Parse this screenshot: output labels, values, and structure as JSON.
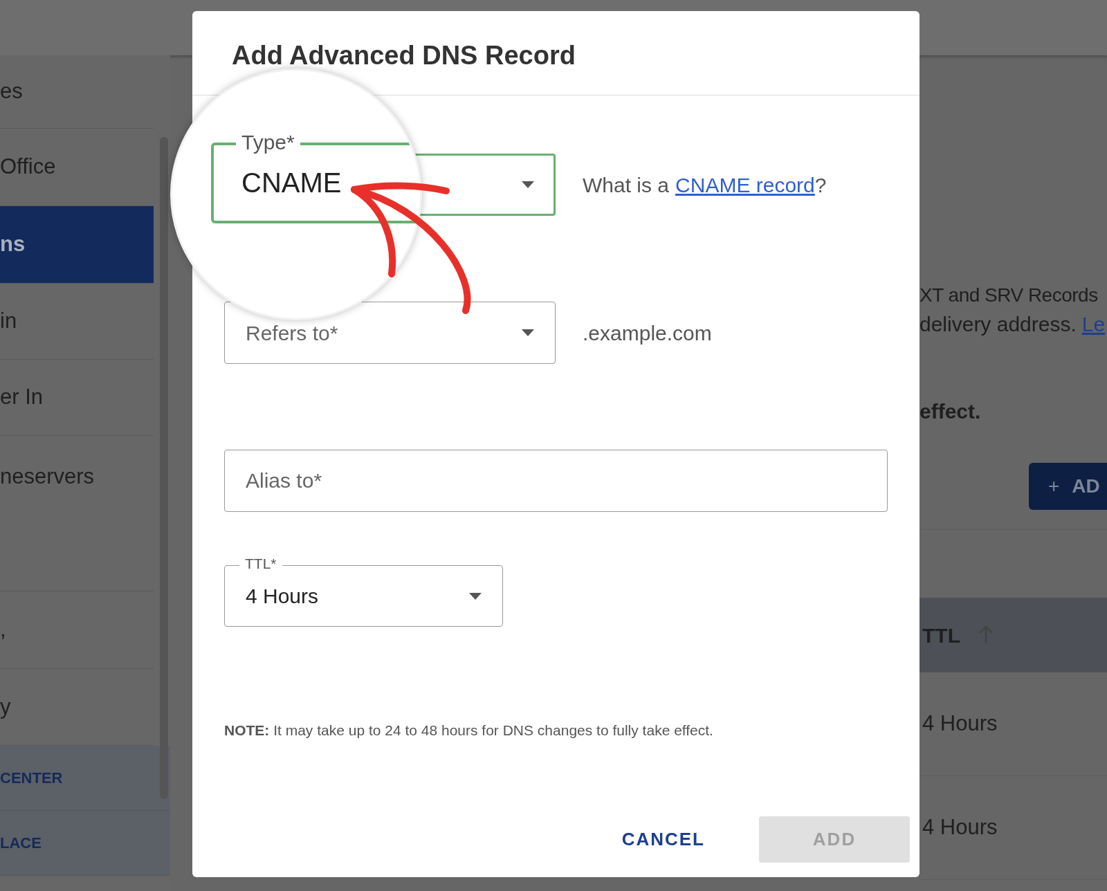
{
  "background_page": {
    "sidebar": {
      "items": [
        {
          "label": "es",
          "selected": false
        },
        {
          "label": "Office",
          "selected": false
        },
        {
          "label": "ns",
          "selected": true
        },
        {
          "label": "in",
          "selected": false
        },
        {
          "label": "er In",
          "selected": false
        },
        {
          "label": "neservers",
          "selected": false
        },
        {
          "label": ",",
          "selected": false
        },
        {
          "label": "y",
          "selected": false
        }
      ],
      "links": [
        "CENTER",
        "LACE"
      ]
    },
    "content": {
      "intro_lines": [
        "XT and SRV Records",
        "delivery address."
      ],
      "intro_link": "Le",
      "note_end": "effect.",
      "add_button": {
        "icon": "+",
        "label": "AD"
      },
      "table": {
        "columns": [
          {
            "label": "TTL",
            "sorted_ascending": true
          }
        ],
        "rows": [
          {
            "ttl": "4 Hours"
          },
          {
            "ttl": "4 Hours"
          }
        ]
      }
    }
  },
  "dialog": {
    "title": "Add Advanced DNS Record",
    "type_field": {
      "label": "Type*",
      "value": "CNAME",
      "focused": true
    },
    "help": {
      "text": "What is a ",
      "link": "CNAME record ",
      "suffix": "?"
    },
    "refers_field": {
      "placeholder": "Refers to*",
      "suffix": ".example.com"
    },
    "alias_field": {
      "placeholder": "Alias to*"
    },
    "ttl_field": {
      "label": "TTL*",
      "value": "4 Hours"
    },
    "note": "**NOTE:** It may take up to 24 to 48 hours for DNS changes to fully take effect.",
    "buttons": [
      {
        "label": "CANCEL",
        "disabled": false
      },
      {
        "label": "ADD",
        "disabled": true
      }
    ]
  }
}
